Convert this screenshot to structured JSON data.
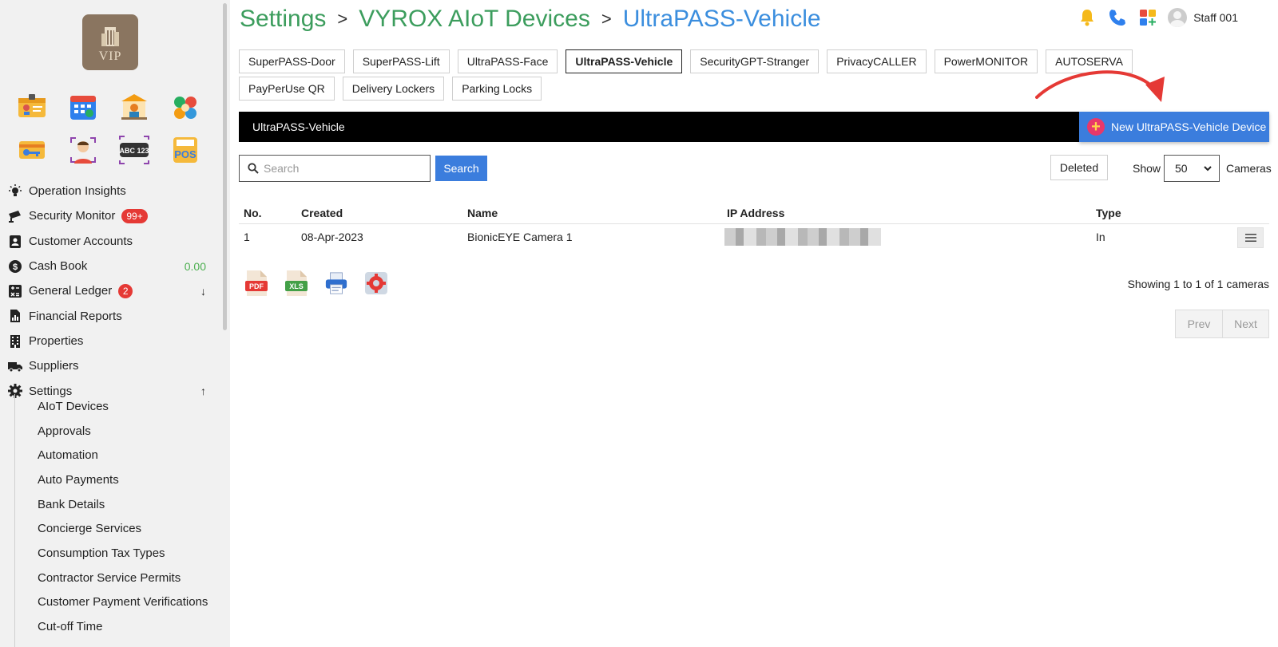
{
  "breadcrumb": {
    "items": [
      "Settings",
      "VYROX AIoT Devices",
      "UltraPASS-Vehicle"
    ],
    "separator": ">"
  },
  "header": {
    "user_name": "Staff 001"
  },
  "logo": {
    "text": "VIP"
  },
  "app_shortcuts": [
    {
      "icon": "id-card-icon"
    },
    {
      "icon": "calendar-icon"
    },
    {
      "icon": "bank-icon"
    },
    {
      "icon": "people-group-icon"
    },
    {
      "icon": "key-card-icon"
    },
    {
      "icon": "face-id-icon"
    },
    {
      "icon": "abc123-icon",
      "label": "ABC 123"
    },
    {
      "icon": "pos-icon",
      "label": "POS"
    }
  ],
  "sidebar": {
    "items": [
      {
        "label": "Operation Insights",
        "icon": "lightbulb-icon"
      },
      {
        "label": "Security Monitor",
        "icon": "cctv-icon",
        "badge": "99+"
      },
      {
        "label": "Customer Accounts",
        "icon": "contact-book-icon"
      },
      {
        "label": "Cash Book",
        "icon": "dollar-circle-icon",
        "value": "0.00"
      },
      {
        "label": "General Ledger",
        "icon": "calculator-icon",
        "badge": "2",
        "arrow": "↓"
      },
      {
        "label": "Financial Reports",
        "icon": "report-icon"
      },
      {
        "label": "Properties",
        "icon": "building-icon"
      },
      {
        "label": "Suppliers",
        "icon": "truck-icon"
      },
      {
        "label": "Settings",
        "icon": "gear-icon",
        "arrow": "↑"
      }
    ],
    "settings_sub": [
      "AIoT Devices",
      "Approvals",
      "Automation",
      "Auto Payments",
      "Bank Details",
      "Concierge Services",
      "Consumption Tax Types",
      "Contractor Service Permits",
      "Customer Payment Verifications",
      "Cut-off Time"
    ]
  },
  "tabs": [
    "SuperPASS-Door",
    "SuperPASS-Lift",
    "UltraPASS-Face",
    "UltraPASS-Vehicle",
    "SecurityGPT-Stranger",
    "PrivacyCALLER",
    "PowerMONITOR",
    "AUTOSERVA",
    "PayPerUse QR",
    "Delivery Lockers",
    "Parking Locks"
  ],
  "active_tab": "UltraPASS-Vehicle",
  "section": {
    "title": "UltraPASS-Vehicle",
    "new_button": "New UltraPASS-Vehicle Device"
  },
  "toolbar": {
    "search_placeholder": "Search",
    "search_button": "Search",
    "deleted_button": "Deleted",
    "show_label": "Show",
    "page_size": "50",
    "cameras_label": "Cameras"
  },
  "table": {
    "columns": [
      "No.",
      "Created",
      "Name",
      "IP Address",
      "Type"
    ],
    "rows": [
      {
        "no": "1",
        "created": "08-Apr-2023",
        "name": "BionicEYE Camera 1",
        "type": "In"
      }
    ]
  },
  "export_icons": [
    "pdf-icon",
    "xls-icon",
    "printer-icon",
    "settings-export-icon"
  ],
  "pagination": {
    "summary": "Showing 1 to 1 of 1 cameras",
    "prev": "Prev",
    "next": "Next"
  },
  "colors": {
    "breadcrumb_green": "#3c9d5d",
    "breadcrumb_blue": "#3b8ede",
    "primary_button": "#3b7ddd",
    "badge_red": "#e53935",
    "arrow_red": "#e53935"
  }
}
